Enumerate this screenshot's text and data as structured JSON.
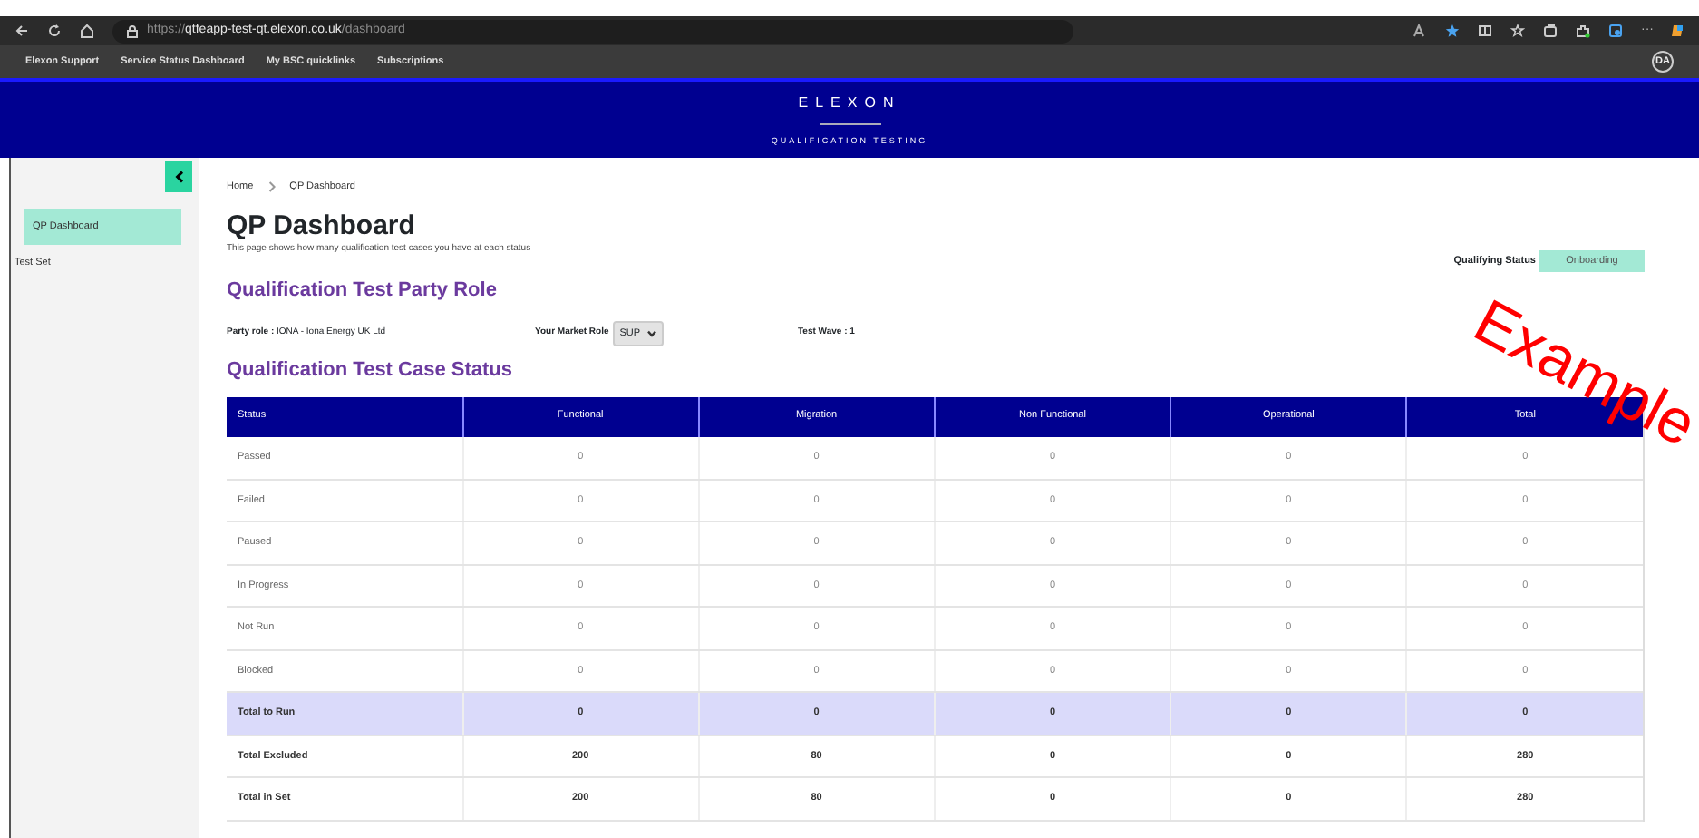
{
  "browser": {
    "url_scheme": "https://",
    "url_host": "qtfeapp-test-qt.elexon.co.uk",
    "url_path": "/dashboard",
    "more_label": "···",
    "bookmarks": [
      "Elexon Support",
      "Service Status Dashboard",
      "My BSC quicklinks",
      "Subscriptions"
    ],
    "profile": "DA"
  },
  "header": {
    "brand": "ELEXON",
    "subtitle": "QUALIFICATION TESTING"
  },
  "sidebar": {
    "items": [
      {
        "label": "QP Dashboard",
        "selected": true
      },
      {
        "label": "Test Set",
        "selected": false
      }
    ]
  },
  "breadcrumb": [
    "Home",
    "QP Dashboard"
  ],
  "page": {
    "title": "QP Dashboard",
    "description": "This page shows how many qualification test cases you have at each status",
    "qualifying_status": {
      "label": "Qualifying Status",
      "value": "Onboarding"
    }
  },
  "party_section": {
    "heading": "Qualification Test Party Role",
    "party_role_label": "Party role :",
    "party_role_value": "IONA - Iona Energy UK Ltd",
    "market_role_label": "Your Market Role",
    "market_role_value": "SUP",
    "test_wave": "Test Wave : 1"
  },
  "status_section": {
    "heading": "Qualification Test Case Status"
  },
  "table": {
    "columns": [
      "Status",
      "Functional",
      "Migration",
      "Non Functional",
      "Operational",
      "Total"
    ],
    "rows": [
      {
        "kind": "status",
        "cells": [
          "Passed",
          "0",
          "0",
          "0",
          "0",
          "0"
        ]
      },
      {
        "kind": "status",
        "cells": [
          "Failed",
          "0",
          "0",
          "0",
          "0",
          "0"
        ]
      },
      {
        "kind": "status",
        "cells": [
          "Paused",
          "0",
          "0",
          "0",
          "0",
          "0"
        ]
      },
      {
        "kind": "status",
        "cells": [
          "In Progress",
          "0",
          "0",
          "0",
          "0",
          "0"
        ]
      },
      {
        "kind": "status",
        "cells": [
          "Not Run",
          "0",
          "0",
          "0",
          "0",
          "0"
        ]
      },
      {
        "kind": "status",
        "cells": [
          "Blocked",
          "0",
          "0",
          "0",
          "0",
          "0"
        ]
      },
      {
        "kind": "highlight",
        "cells": [
          "Total to Run",
          "0",
          "0",
          "0",
          "0",
          "0"
        ]
      },
      {
        "kind": "total",
        "cells": [
          "Total Excluded",
          "200",
          "80",
          "0",
          "0",
          "280"
        ]
      },
      {
        "kind": "total",
        "cells": [
          "Total in Set",
          "200",
          "80",
          "0",
          "0",
          "280"
        ]
      }
    ]
  },
  "stamp": "Example"
}
